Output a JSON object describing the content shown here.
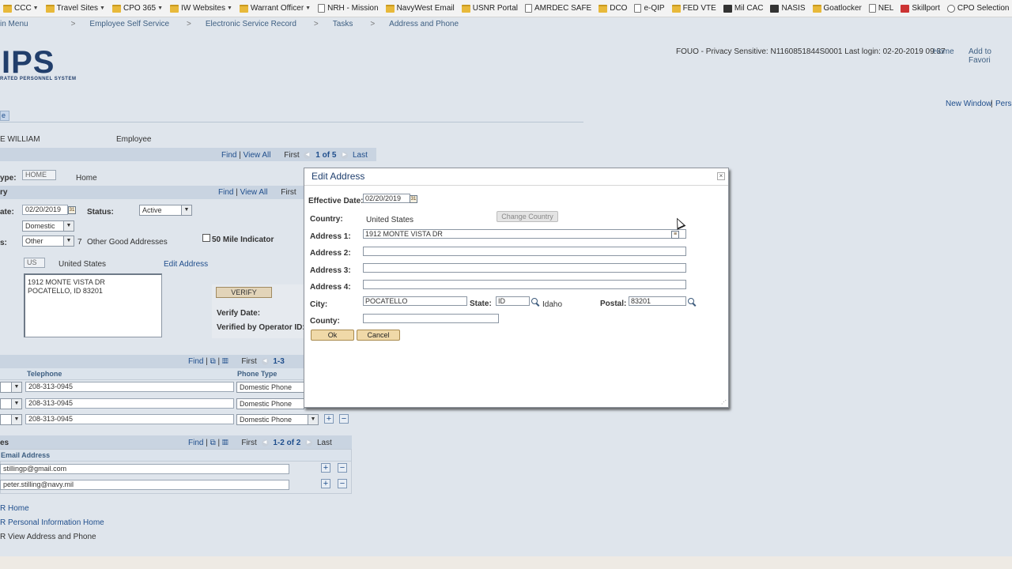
{
  "bookmarks": [
    {
      "label": "CCC",
      "icon": "folder-icon",
      "menu": true
    },
    {
      "label": "Travel Sites",
      "icon": "folder-icon",
      "menu": true
    },
    {
      "label": "CPO 365",
      "icon": "folder-icon",
      "menu": true
    },
    {
      "label": "IW Websites",
      "icon": "folder-icon",
      "menu": true
    },
    {
      "label": "Warrant Officer",
      "icon": "folder-icon",
      "menu": true
    },
    {
      "label": "NRH - Mission",
      "icon": "page-icon",
      "menu": false
    },
    {
      "label": "NavyWest Email",
      "icon": "folder-icon",
      "menu": false
    },
    {
      "label": "USNR Portal",
      "icon": "folder-icon",
      "menu": false
    },
    {
      "label": "AMRDEC SAFE",
      "icon": "page-icon",
      "menu": false
    },
    {
      "label": "DCO",
      "icon": "folder-icon",
      "menu": false
    },
    {
      "label": "e-QIP",
      "icon": "page-icon",
      "menu": false
    },
    {
      "label": "FED VTE",
      "icon": "folder-icon",
      "menu": false
    },
    {
      "label": "Mil CAC",
      "icon": "dark-icon",
      "menu": false
    },
    {
      "label": "NASIS",
      "icon": "dark-icon",
      "menu": false
    },
    {
      "label": "Goatlocker",
      "icon": "folder-icon",
      "menu": false
    },
    {
      "label": "NEL",
      "icon": "page-icon",
      "menu": false
    },
    {
      "label": "Skillport",
      "icon": "red-icon",
      "menu": false
    },
    {
      "label": "CPO Selection Boards",
      "icon": "globe-icon",
      "menu": false
    }
  ],
  "breadcrumb": [
    "in Menu",
    "Employee Self Service",
    "Electronic Service Record",
    "Tasks",
    "Address and Phone"
  ],
  "breadcrumb_sep": ">",
  "logo": {
    "text": "IPS",
    "subtitle": "RATED PERSONNEL SYSTEM"
  },
  "header": {
    "info": "FOUO - Privacy Sensitive: N1160851844S0001 Last login: 02-20-2019 09:37",
    "home_link": "Home",
    "favorites_link": "Add to Favori",
    "new_window": "New Window",
    "sep": "|",
    "personalize": "Perso"
  },
  "tab_fragment": "e",
  "person": {
    "name": "E WILLIAM",
    "role": "Employee"
  },
  "pager1": {
    "find": "Find",
    "sep": "|",
    "view_all": "View All",
    "first": "First",
    "count": "1 of 5",
    "last": "Last"
  },
  "address_type": {
    "label": "ype:",
    "value": "HOME",
    "desc": "Home"
  },
  "history": {
    "label": "ry",
    "find": "Find",
    "sep": "|",
    "view_all": "View All",
    "first": "First"
  },
  "eff_date": {
    "label": "ate:",
    "value": "02/20/2019"
  },
  "status": {
    "label": "Status:",
    "value": "Active"
  },
  "domestic": {
    "value": "Domestic"
  },
  "reason": {
    "label": "s:",
    "value": "Other",
    "code": "7",
    "desc": "Other Good Addresses"
  },
  "fifty_mile": "50 Mile Indicator",
  "country_row": {
    "code": "US",
    "name": "United States",
    "edit_link": "Edit Address"
  },
  "address_display": {
    "line1": "1912 MONTE VISTA DR",
    "line2": "POCATELLO, ID 83201"
  },
  "verify": {
    "button": "VERIFY",
    "date_label": "Verify Date:",
    "operator_label": "Verified by Operator ID:"
  },
  "phones": {
    "pager": {
      "find": "Find",
      "sep": "|",
      "first": "First",
      "count": "1-3"
    },
    "col_phone": "Telephone",
    "col_type": "Phone Type",
    "rows": [
      {
        "number": "208-313-0945",
        "type": "Domestic Phone"
      },
      {
        "number": "208-313-0945",
        "type": "Domestic Phone"
      },
      {
        "number": "208-313-0945",
        "type": "Domestic Phone"
      }
    ]
  },
  "emails": {
    "section_label": "es",
    "pager": {
      "find": "Find",
      "sep": "|",
      "first": "First",
      "count": "1-2 of 2",
      "last": "Last"
    },
    "col_email": "Email Address",
    "rows": [
      "stillingp@gmail.com",
      "peter.stilling@navy.mil"
    ]
  },
  "footer_links": [
    "R Home",
    "R Personal Information Home",
    "R View Address and Phone"
  ],
  "modal": {
    "title": "Edit Address",
    "close": "×",
    "effective_date_label": "Effective Date:",
    "effective_date": "02/20/2019",
    "country_label": "Country:",
    "country": "United States",
    "change_country": "Change Country",
    "address1_label": "Address 1:",
    "address1": "1912 MONTE VISTA DR",
    "address2_label": "Address 2:",
    "address2": "",
    "address3_label": "Address 3:",
    "address3": "",
    "address4_label": "Address 4:",
    "address4": "",
    "city_label": "City:",
    "city": "POCATELLO",
    "state_label": "State:",
    "state": "ID",
    "state_name": "Idaho",
    "postal_label": "Postal:",
    "postal": "83201",
    "county_label": "County:",
    "county": "",
    "ok": "Ok",
    "cancel": "Cancel"
  },
  "colors": {
    "link": "#1f4e8c",
    "header_bar": "#c9d4e1",
    "background": "#dfe5ec",
    "button": "#f0d9a8"
  }
}
